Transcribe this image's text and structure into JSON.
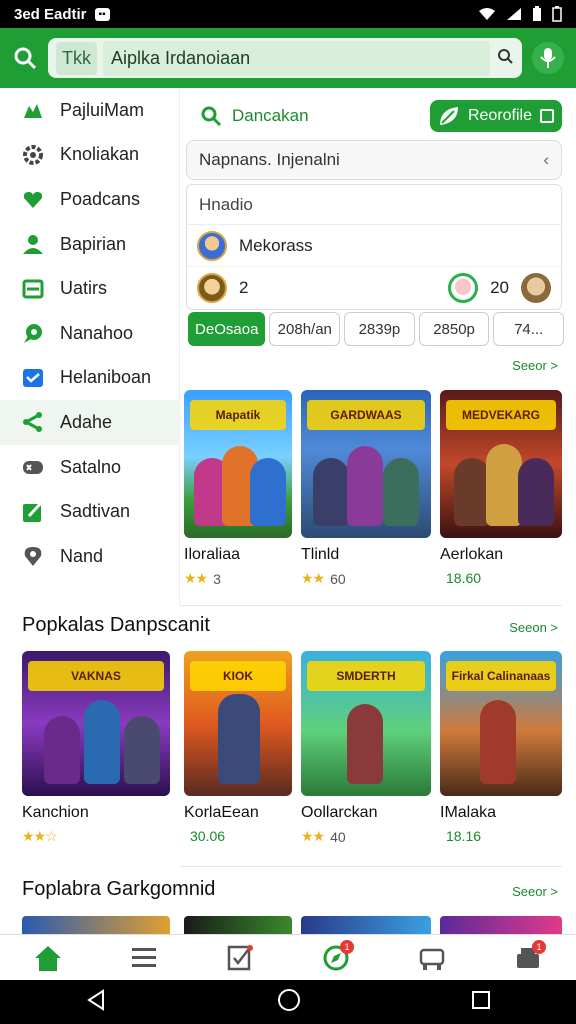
{
  "status_bar": {
    "time_text": "3ed Eadtir",
    "badge": "▪▪"
  },
  "top_bar": {
    "tab_label": "Tkk",
    "search_value": "Aiplka Irdanoiaan"
  },
  "sidebar": {
    "items": [
      {
        "label": "PajluiMam",
        "icon": "puzzle-icon"
      },
      {
        "label": "Knoliakan",
        "icon": "gear-icon"
      },
      {
        "label": "Poadcans",
        "icon": "heart-icon"
      },
      {
        "label": "Bapirian",
        "icon": "person-icon"
      },
      {
        "label": "Uatirs",
        "icon": "card-icon"
      },
      {
        "label": "Nanahoo",
        "icon": "chat-icon"
      },
      {
        "label": "Helaniboan",
        "icon": "check-box-icon"
      },
      {
        "label": "Adahe",
        "icon": "share-icon"
      },
      {
        "label": "Satalno",
        "icon": "gamepad-icon"
      },
      {
        "label": "Sadtivan",
        "icon": "edit-icon"
      },
      {
        "label": "Nand",
        "icon": "location-icon"
      }
    ]
  },
  "browse": {
    "label": "Dancakan",
    "recent_button": "Reorofile"
  },
  "filter": {
    "value": "Napnans. Injenalni"
  },
  "results": {
    "header": "Hnadio",
    "rows": [
      {
        "name": "Mekorass"
      },
      {
        "name": "2",
        "value": "20"
      }
    ]
  },
  "pills": [
    "DeOsaoa",
    "208h/an",
    "2839p",
    "2850p",
    "74..."
  ],
  "see_all": "Seeor >",
  "row1_cards": [
    {
      "logo": "Mapatik",
      "title": "Iloraliaa",
      "stars": "★★",
      "value": "3",
      "green": false
    },
    {
      "logo": "GARDWAAS",
      "title": "Tlinld",
      "stars": "★★",
      "value": "60",
      "green": false
    },
    {
      "logo": "MEDVEKARG",
      "title": "Aerlokan",
      "stars": "",
      "value": "18.60",
      "green": true
    }
  ],
  "section2": {
    "title": "Popkalas Danpscanit",
    "see_all": "Seeon >",
    "cards": [
      {
        "logo": "VAKNAS",
        "title": "Kanchion",
        "stars": "★★☆",
        "value": "",
        "green": false
      },
      {
        "logo": "KIOK",
        "title": "KorlaEean",
        "stars": "",
        "value": "30.06",
        "green": true
      },
      {
        "logo": "SMDERTH",
        "title": "Oollarckan",
        "stars": "★★",
        "value": "40",
        "green": false
      },
      {
        "logo": "Firkal Calinanaas",
        "title": "IMalaka",
        "stars": "",
        "value": "18.16",
        "green": true
      }
    ]
  },
  "section3": {
    "title": "Foplabra Garkgomnid",
    "see_all": "Seeor >"
  },
  "bottom_nav": [
    {
      "icon": "home-icon",
      "badge": ""
    },
    {
      "icon": "list-icon",
      "badge": ""
    },
    {
      "icon": "checklist-icon",
      "badge": ""
    },
    {
      "icon": "compass-icon",
      "badge": "1"
    },
    {
      "icon": "store-icon",
      "badge": ""
    },
    {
      "icon": "profile-icon",
      "badge": "1"
    }
  ],
  "colors": {
    "brand": "#1f9e35",
    "accent_text": "#1b8a2e",
    "star": "#e8b21a"
  }
}
